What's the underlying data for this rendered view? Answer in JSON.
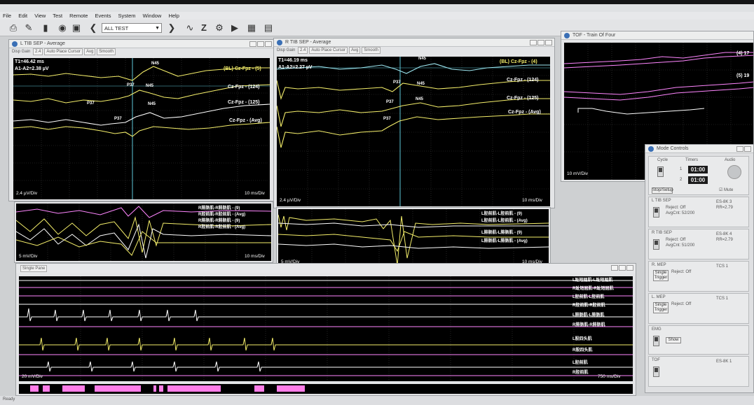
{
  "app": {
    "title": "",
    "menu": [
      "File",
      "Edit",
      "View",
      "Test",
      "Remote",
      "Events",
      "System",
      "Window",
      "Help"
    ],
    "test_combo": "ALL TEST"
  },
  "colors": {
    "yellow": "#f4ee6a",
    "white": "#ffffff",
    "cyan": "#9ee8f2",
    "magenta": "#ff86ff"
  },
  "windows": {
    "l_tib": {
      "title": "L TIB SEP - Average",
      "disp_gain_label": "Disp Gain",
      "disp_gain": "2.4",
      "buttons": [
        "Auto Place Cursor",
        "Avg",
        "Smooth"
      ],
      "cursor_t1": "T1=46.42 ms",
      "cursor_a": "A1-A2=2.38 µV",
      "traces": [
        "(BL) Cz-Fpz - (5)",
        "Cz-Fpz - (124)",
        "Cz-Fpz - (125)",
        "Cz-Fpz - (Avg)"
      ],
      "markers": [
        "N45",
        "P37",
        "N45",
        "P37",
        "N45",
        "P37"
      ],
      "y_scale": "2.4 µV/Div",
      "x_scale": "10 ms/Div"
    },
    "r_tib": {
      "title": "R TIB SEP - Average",
      "disp_gain_label": "Disp Gain",
      "disp_gain": "2.4",
      "buttons": [
        "Auto Place Cursor",
        "Avg",
        "Smooth"
      ],
      "cursor_t1": "T1=46.19 ms",
      "cursor_a": "A1-A2=2.27 µV",
      "traces": [
        "(BL) Cz-Fpz - (4)",
        "Cz-Fpz - (124)",
        "Cz-Fpz - (125)",
        "Cz-Fpz - (Avg)"
      ],
      "markers": [
        "N45",
        "P37",
        "N45",
        "P37",
        "N45",
        "P37"
      ],
      "y_scale": "2.4 µV/Div",
      "x_scale": "10 ms/Div"
    },
    "tof": {
      "title": "TOF - Train Of Four",
      "labels": [
        "(4) 17",
        "(5) 19"
      ],
      "y_scale": "10 mV/Div"
    },
    "r_emg": {
      "traces": [
        "R腓肠肌-R腓肠肌 - (9)",
        "R胫前肌-R胫前肌 - (Avg)",
        "R腓肠肌-R腓肠肌 - (9)",
        "R胫前肌-R胫前肌 - (Avg)"
      ],
      "y_scale": "5 mV/Div",
      "x_scale": "10 ms/Div"
    },
    "l_emg": {
      "traces": [
        "L胫前肌-L胫前肌 - (9)",
        "L胫前肌-L胫前肌 - (Avg)",
        "L腓肠肌-L腓肠肌 - (9)",
        "L腓肠肌-L腓肠肌 - (Avg)"
      ],
      "y_scale": "5 mV/Div",
      "x_scale": "10 ms/Div"
    },
    "freerun": {
      "mode": "Single Pane",
      "x_scale": "750 ms/Div",
      "y_scale": "20 mV/Div",
      "channels": [
        "L趾短屈肌-L趾短屈肌",
        "R趾短屈肌-R趾短屈肌",
        "L胫前肌-L胫前肌",
        "R胫前肌-R胫前肌",
        "L腓肠肌-L腓肠肌",
        "R腓肠肌-R腓肠肌",
        "L股四头肌",
        "R股四头肌",
        "L胫前肌",
        "R胫前肌"
      ]
    }
  },
  "mode_controls": {
    "title": "Mode Controls",
    "cycle": "Cycle",
    "timers": "Timers",
    "audio": "Audio",
    "timer1_label": "1",
    "timer1": "01:00",
    "timer2_label": "2",
    "timer2": "01:00",
    "mute": "Mute",
    "stop_setup": "Stop/Setup",
    "l_tib": {
      "name": "L TIB SEP",
      "reject": "Reject: Off",
      "avg": "AvgCnt: 52/200",
      "info1": "ES-8K 3",
      "info2": "RR=2.79"
    },
    "r_tib": {
      "name": "R TIB SEP",
      "reject": "Reject: Off",
      "avg": "AvgCnt: 51/200",
      "info1": "ES-8K 4",
      "info2": "RR=2.79"
    },
    "r_mep": {
      "name": "R. MEP",
      "trigger": "Single Trigger",
      "reject": "Reject: Off",
      "info1": "TCS 1"
    },
    "l_mep": {
      "name": "L. MEP",
      "trigger": "Single Trigger",
      "reject": "Reject: Off",
      "info1": "TCS 1"
    },
    "emg": {
      "name": "EMG",
      "button": "Show"
    },
    "tof": {
      "name": "TOF",
      "info1": "ES-8K 1"
    }
  },
  "status": "Ready"
}
